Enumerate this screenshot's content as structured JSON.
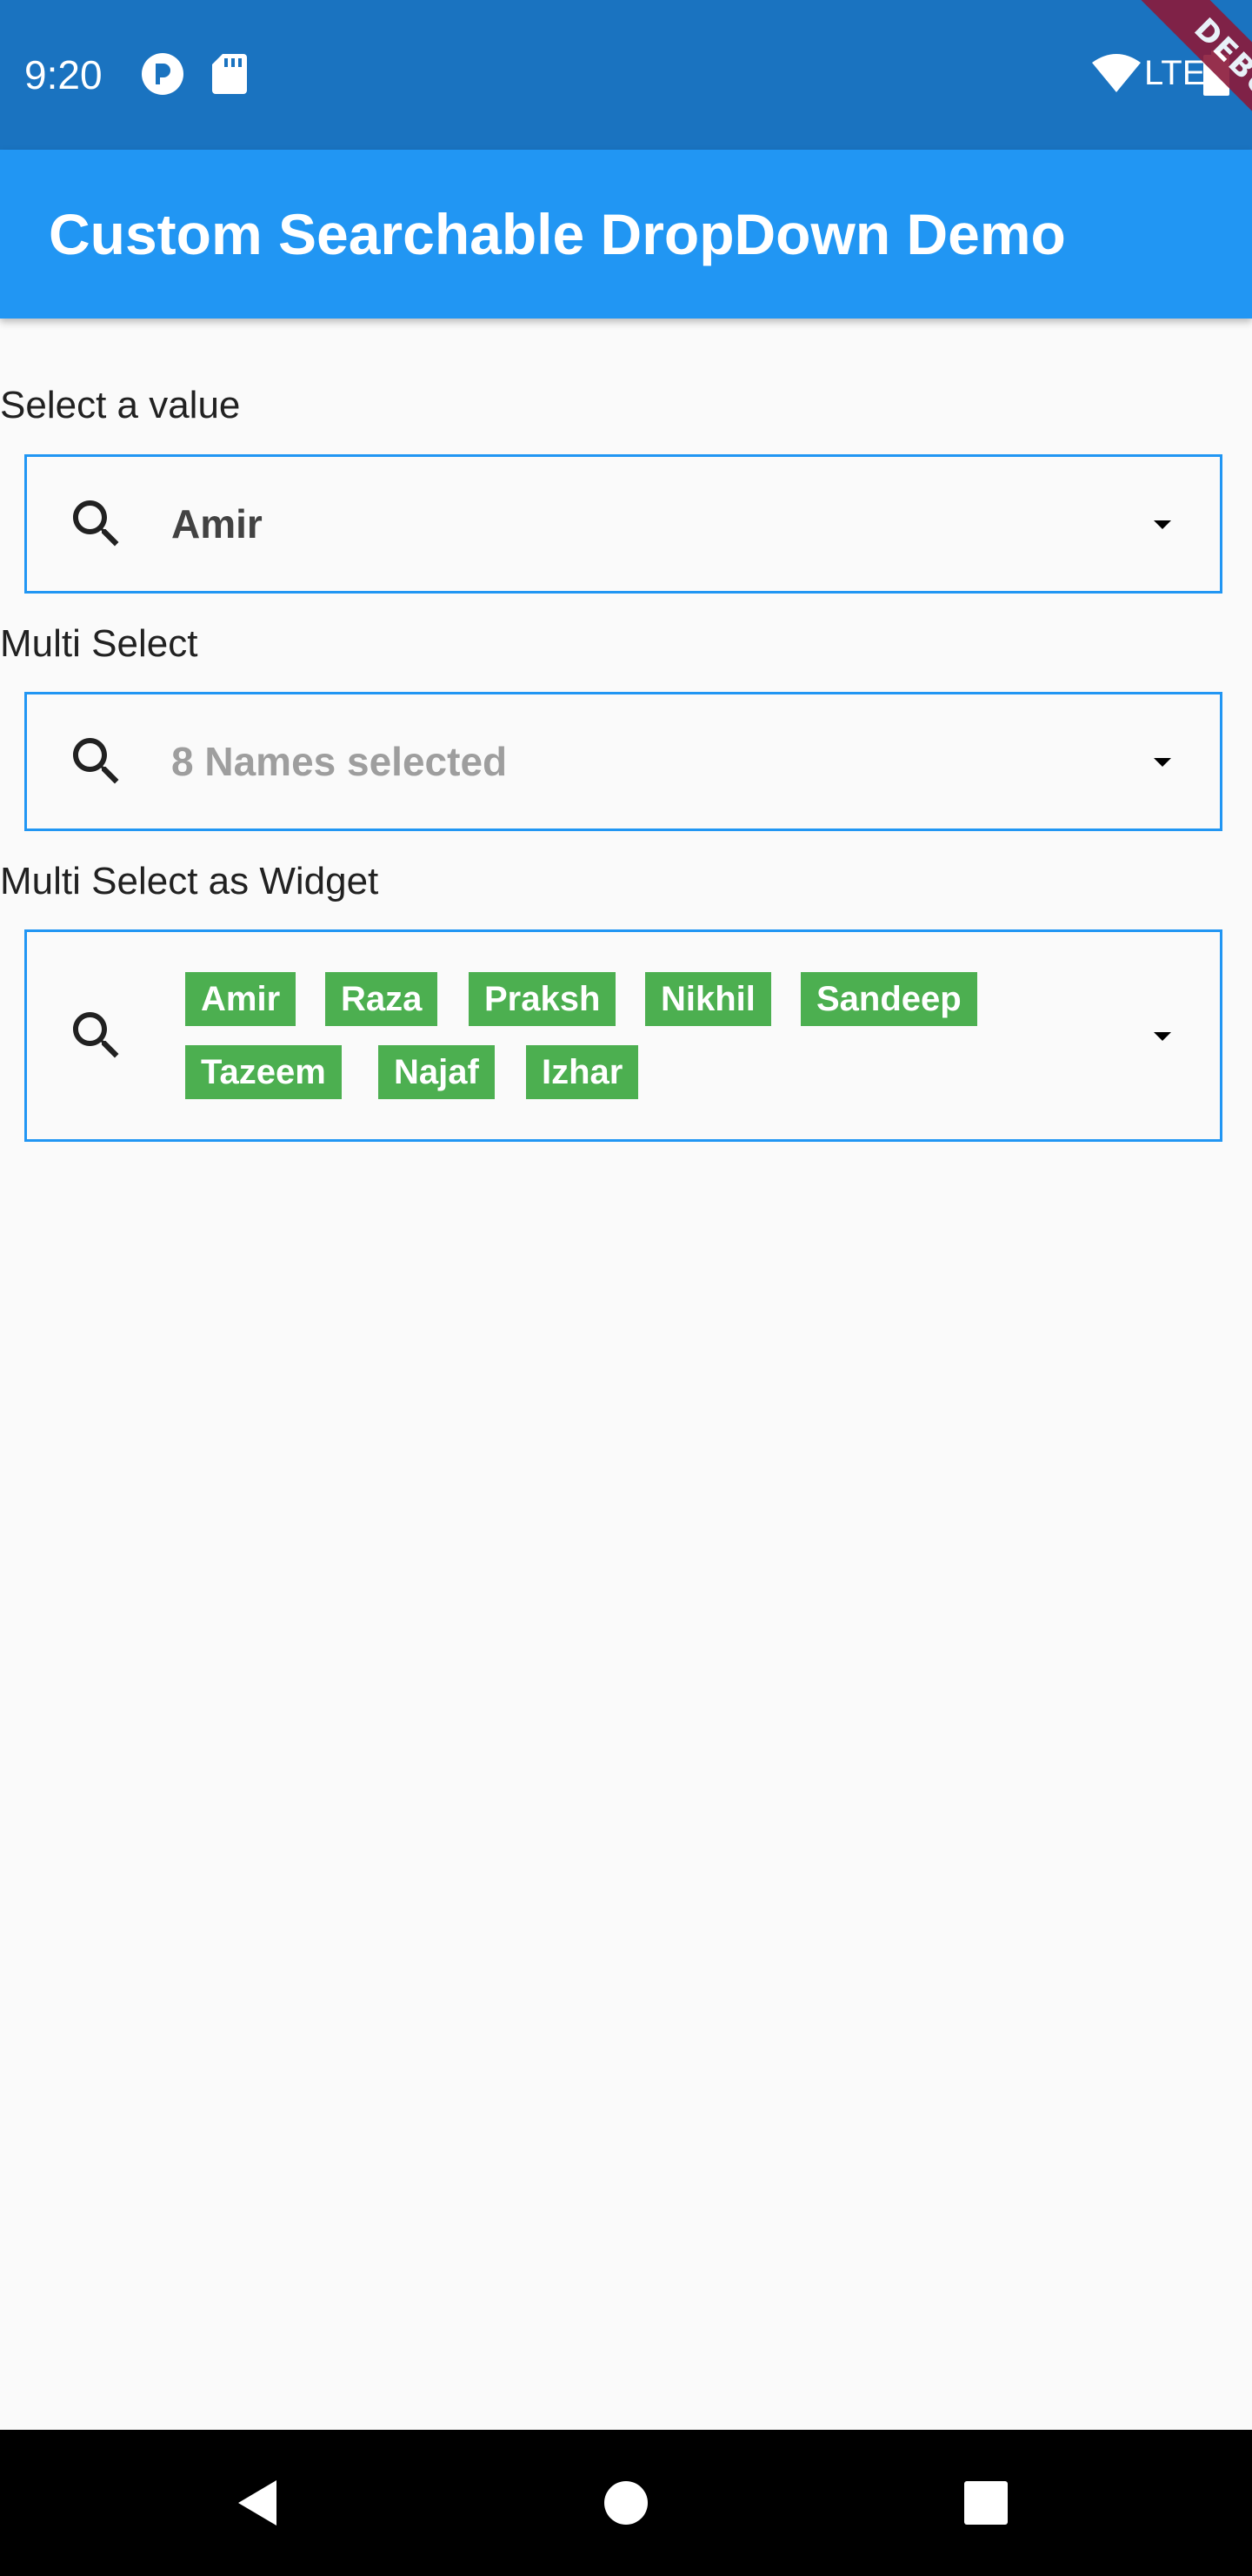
{
  "status_bar": {
    "time": "9:20",
    "network": "LTE",
    "debug_banner": "DEBUG",
    "icons": [
      "notification-icon",
      "sd-card-icon",
      "wifi-icon",
      "battery-icon"
    ]
  },
  "app_bar": {
    "title": "Custom Searchable DropDown Demo",
    "color": "#2196f3"
  },
  "fields": [
    {
      "label": "Select a value",
      "value": "Amir",
      "icon": "search-icon"
    },
    {
      "label": "Multi Select",
      "hint": "8 Names selected",
      "icon": "search-icon"
    },
    {
      "label": "Multi Select as Widget",
      "chips": [
        "Amir",
        "Raza",
        "Praksh",
        "Nikhil",
        "Sandeep",
        "Tazeem",
        "Najaf",
        "Izhar"
      ],
      "chip_color": "#4caf50",
      "icon": "search-icon"
    }
  ],
  "nav_bar": {
    "buttons": [
      "back-icon",
      "home-icon",
      "recents-icon"
    ]
  }
}
